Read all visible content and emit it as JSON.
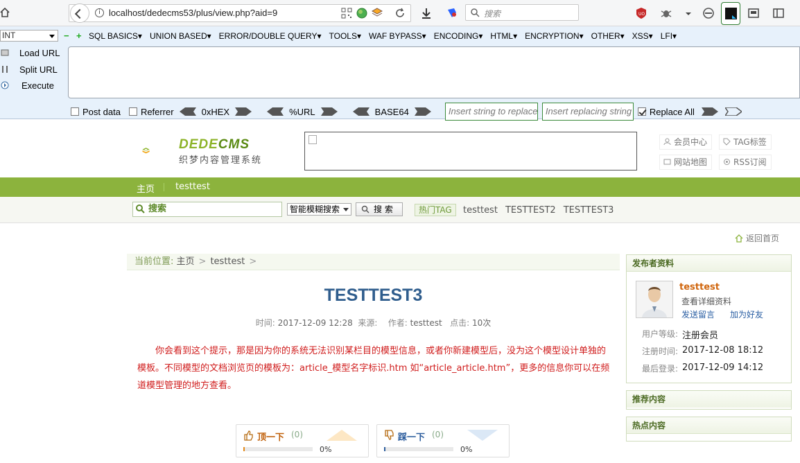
{
  "browser": {
    "url": "localhost/dedecms53/plus/view.php?aid=9",
    "search_placeholder": "搜索"
  },
  "hackbar": {
    "type_select": "INT",
    "menu": [
      "SQL BASICS▾",
      "UNION BASED▾",
      "ERROR/DOUBLE QUERY▾",
      "TOOLS▾",
      "WAF BYPASS▾",
      "ENCODING▾",
      "HTML▾",
      "ENCRYPTION▾",
      "OTHER▾",
      "XSS▾",
      "LFI▾"
    ],
    "load_url": "Load URL",
    "split_url": "Split URL",
    "execute": "Execute",
    "post_data": "Post data",
    "referrer": "Referrer",
    "hex": "0xHEX",
    "url_enc": "%URL",
    "base64": "BASE64",
    "replace_from_ph": "Insert string to replace",
    "replace_to_ph": "Insert replacing string",
    "replace_all": "Replace All",
    "replace_all_checked": true
  },
  "site": {
    "logo_main": "DEDE",
    "logo_cms": "CMS",
    "logo_sub": "织梦内容管理系统",
    "toplinks": [
      "会员中心",
      "TAG标签",
      "网站地图",
      "RSS订阅"
    ],
    "nav": [
      "主页",
      "testtest"
    ],
    "search_label": "搜索",
    "search_mode": "智能模糊搜索",
    "search_btn": "搜 索",
    "hot_tag_label": "热门TAG",
    "hot_tags": [
      "testtest",
      "TESTTEST2",
      "TESTTEST3"
    ],
    "back_home": "返回首页"
  },
  "article": {
    "breadcrumb_label": "当前位置:",
    "breadcrumb": [
      "主页",
      "testtest"
    ],
    "title": "TESTTEST3",
    "time_label": "时间:",
    "time": "2017-12-09 12:28",
    "source_label": "来源:",
    "author_label": "作者:",
    "author": "testtest",
    "clicks_label": "点击:",
    "clicks": "10次",
    "body": "你会看到这个提示，那是因为你的系统无法识别某栏目的模型信息，或者你新建模型后，没为这个模型设计单独的模板。不同模型的文档浏览页的模板为：article_模型名字标识.htm 如“article_article.htm”，更多的信息你可以在频道模型管理的地方查看。",
    "vote_up_label": "顶一下",
    "vote_up_count": "(0)",
    "vote_up_pct": "0%",
    "vote_down_label": "踩一下",
    "vote_down_count": "(0)",
    "vote_down_pct": "0%"
  },
  "sidebar": {
    "publisher_title": "发布者资料",
    "username": "testtest",
    "view_profile": "查看详细资料",
    "send_msg": "发送留言",
    "add_friend": "加为好友",
    "level_label": "用户等级:",
    "level": "注册会员",
    "reg_label": "注册时间:",
    "reg_time": "2017-12-08 18:12",
    "login_label": "最后登录:",
    "login_time": "2017-12-09 14:12",
    "recommend_title": "推荐内容",
    "hot_title": "热点内容"
  },
  "colors": {
    "nav_green": "#8cb33d",
    "title_blue": "#2f5d8d",
    "body_red": "#d01c1c"
  }
}
